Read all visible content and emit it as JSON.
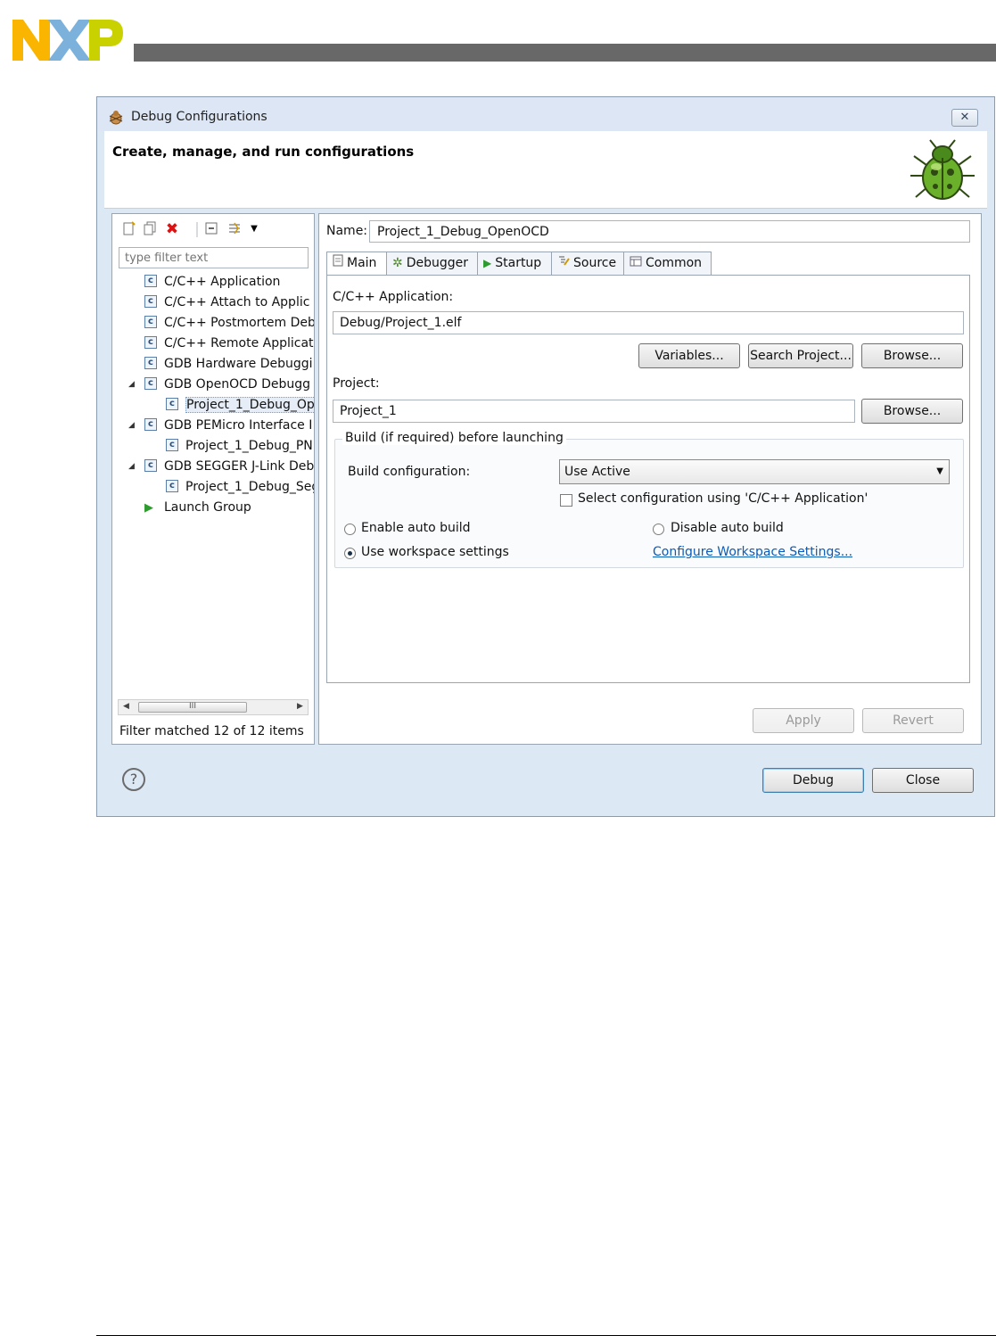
{
  "dialog": {
    "title": "Debug Configurations",
    "close_glyph": "✕",
    "banner_title": "Create, manage, and run configurations"
  },
  "left": {
    "filter_placeholder": "type filter text",
    "tree": [
      {
        "label": "C/C++ Application",
        "level": 0,
        "expanded": null,
        "selected": false,
        "icon": "c-config-icon"
      },
      {
        "label": "C/C++ Attach to Applic",
        "level": 0,
        "expanded": null,
        "selected": false,
        "icon": "c-config-icon"
      },
      {
        "label": "C/C++ Postmortem Deb",
        "level": 0,
        "expanded": null,
        "selected": false,
        "icon": "c-config-icon"
      },
      {
        "label": "C/C++ Remote Applicat",
        "level": 0,
        "expanded": null,
        "selected": false,
        "icon": "c-config-icon"
      },
      {
        "label": "GDB Hardware Debuggi",
        "level": 0,
        "expanded": null,
        "selected": false,
        "icon": "c-config-icon"
      },
      {
        "label": "GDB OpenOCD Debugg",
        "level": 0,
        "expanded": true,
        "selected": false,
        "icon": "c-config-icon"
      },
      {
        "label": "Project_1_Debug_Op",
        "level": 1,
        "expanded": null,
        "selected": true,
        "icon": "c-config-icon"
      },
      {
        "label": "GDB PEMicro Interface I",
        "level": 0,
        "expanded": true,
        "selected": false,
        "icon": "c-config-icon"
      },
      {
        "label": "Project_1_Debug_PN",
        "level": 1,
        "expanded": null,
        "selected": false,
        "icon": "c-config-icon"
      },
      {
        "label": "GDB SEGGER J-Link Deb",
        "level": 0,
        "expanded": true,
        "selected": false,
        "icon": "c-config-icon"
      },
      {
        "label": "Project_1_Debug_Seg",
        "level": 1,
        "expanded": null,
        "selected": false,
        "icon": "c-config-icon"
      },
      {
        "label": "Launch Group",
        "level": 0,
        "expanded": null,
        "selected": false,
        "icon": "launch-group-icon"
      }
    ],
    "scroll_grip": "III",
    "status": "Filter matched 12 of 12 items"
  },
  "right": {
    "name_label": "Name:",
    "name_value": "Project_1_Debug_OpenOCD",
    "tabs": [
      {
        "label": "Main",
        "icon": "main-tab-icon",
        "active": true
      },
      {
        "label": "Debugger",
        "icon": "debugger-tab-icon",
        "active": false
      },
      {
        "label": "Startup",
        "icon": "startup-tab-icon",
        "active": false
      },
      {
        "label": "Source",
        "icon": "source-tab-icon",
        "active": false
      },
      {
        "label": "Common",
        "icon": "common-tab-icon",
        "active": false
      }
    ],
    "app_label": "C/C++ Application:",
    "app_value": "Debug/Project_1.elf",
    "variables_btn": "Variables...",
    "search_btn": "Search Project...",
    "browse_btn": "Browse...",
    "project_label": "Project:",
    "project_value": "Project_1",
    "project_browse_btn": "Browse...",
    "build": {
      "legend": "Build (if required) before launching",
      "config_label": "Build configuration:",
      "config_value": "Use Active",
      "select_checkbox_label": "Select configuration using 'C/C++ Application'",
      "select_checkbox_checked": false,
      "enable_auto": "Enable auto build",
      "disable_auto": "Disable auto build",
      "use_workspace": "Use workspace settings",
      "configure_link": "Configure Workspace Settings...",
      "selected_option": "use_workspace"
    },
    "apply_btn": "Apply",
    "revert_btn": "Revert"
  },
  "footer": {
    "help_glyph": "?",
    "debug_btn": "Debug",
    "close_btn": "Close"
  },
  "colors": {
    "nxp_n": "#f9b500",
    "nxp_x": "#7bb1db",
    "nxp_p": "#c9d200",
    "header_bar": "#686868",
    "link": "#0b5bb8"
  }
}
